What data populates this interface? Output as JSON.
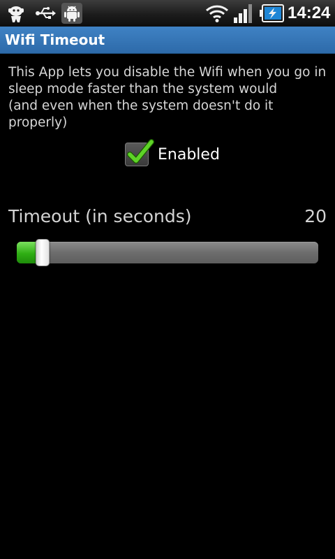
{
  "status_bar": {
    "icons_left": [
      "developer-mascot-icon",
      "usb-icon",
      "android-debug-icon"
    ],
    "icons_right": [
      "wifi-icon",
      "signal-icon",
      "battery-charging-icon"
    ],
    "time": "14:24"
  },
  "title_bar": {
    "title": "Wifi Timeout"
  },
  "main": {
    "description_lines": [
      "This App lets you disable the Wifi when you go in",
      "sleep mode faster than the system would",
      "(and even when the system doesn't do it",
      "properly)"
    ],
    "enabled_checkbox": {
      "label": "Enabled",
      "checked": true
    },
    "timeout": {
      "label": "Timeout (in seconds)",
      "value": "20",
      "slider_fraction": 0.065
    }
  },
  "colors": {
    "title_bar": "#3a78b8",
    "check_green": "#5ed327",
    "slider_fill": "#33b516",
    "background": "#000000"
  }
}
